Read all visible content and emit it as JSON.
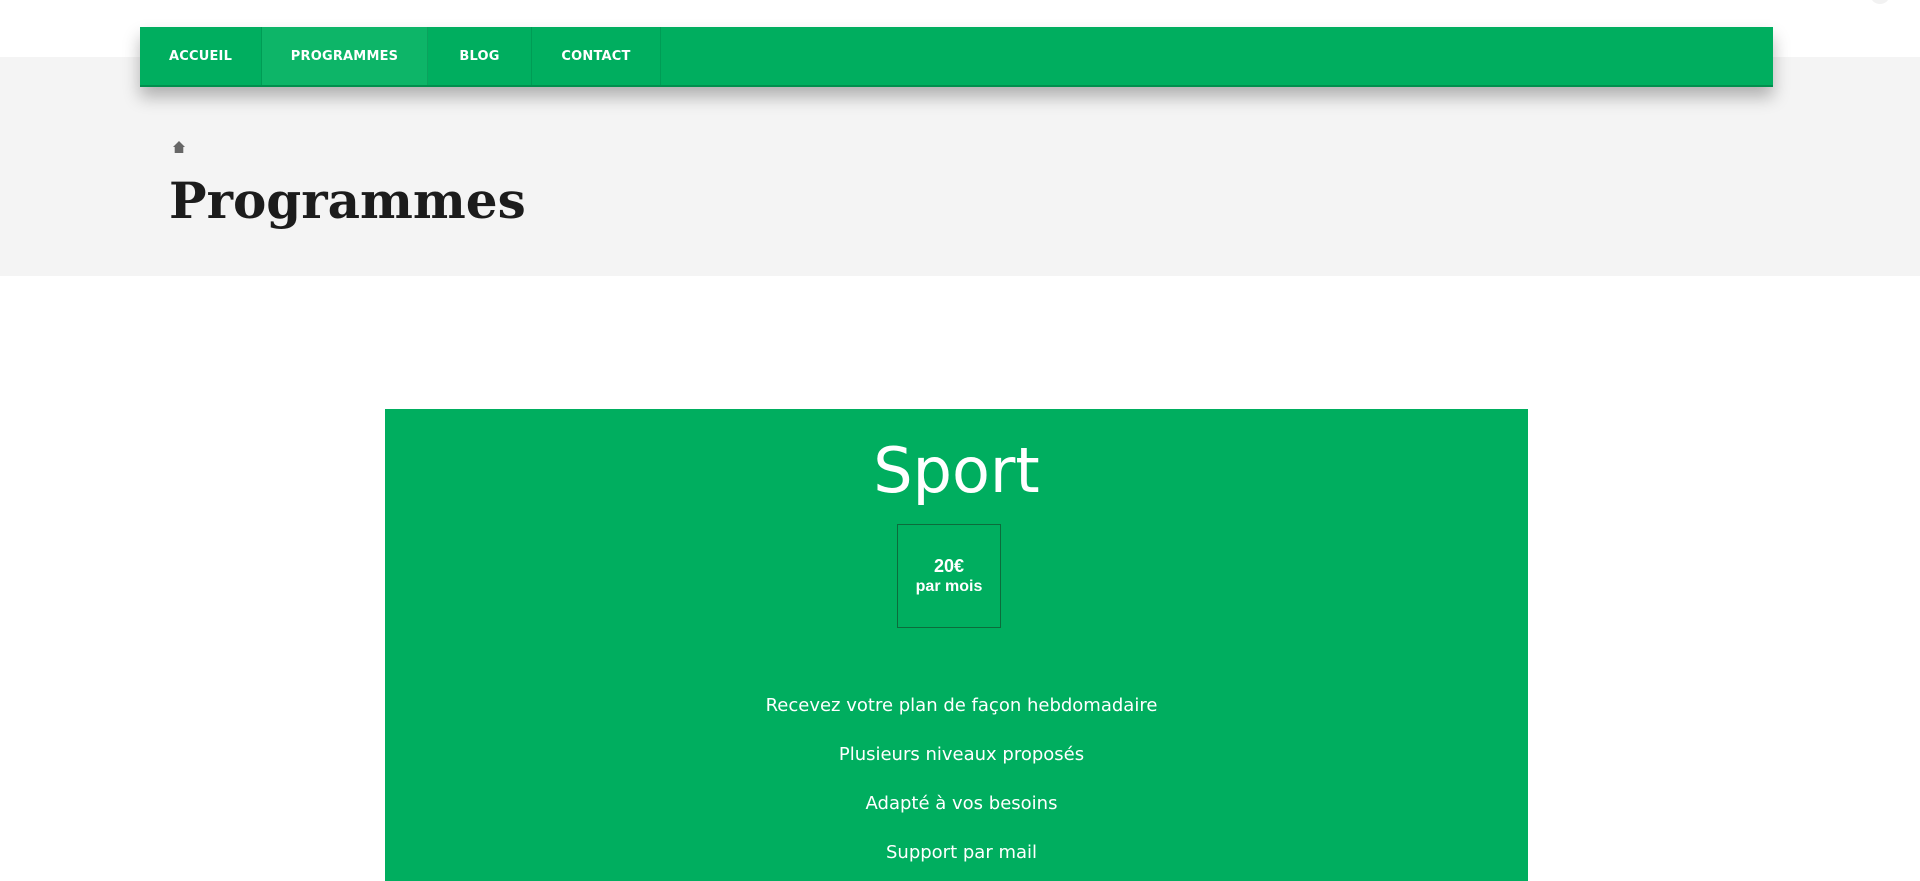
{
  "nav": {
    "items": [
      {
        "label": "ACCUEIL",
        "active": false
      },
      {
        "label": "PROGRAMMES",
        "active": true
      },
      {
        "label": "BLOG",
        "active": false
      },
      {
        "label": "CONTACT",
        "active": false
      }
    ]
  },
  "breadcrumb": {
    "icon": "home-icon"
  },
  "page": {
    "title": "Programmes"
  },
  "pricing": {
    "plan_name": "Sport",
    "price": "20€",
    "period": "par mois",
    "features": [
      "Recevez votre plan de façon hebdomadaire",
      "Plusieurs niveaux proposés",
      "Adapté à vos besoins",
      "Support par mail"
    ]
  },
  "colors": {
    "brand_green": "#00ae5f",
    "header_band": "#f4f4f4",
    "title_text": "#1c1c1c"
  }
}
